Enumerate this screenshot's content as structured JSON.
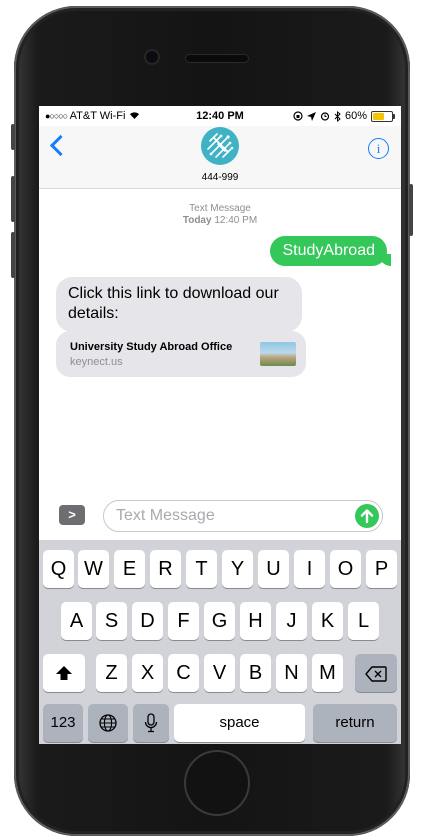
{
  "status_bar": {
    "signal": "●○○○○",
    "carrier": "AT&T Wi-Fi",
    "time": "12:40 PM",
    "battery_percent": "60%",
    "battery_level": 0.6
  },
  "nav": {
    "contact": "444-999",
    "info_glyph": "i"
  },
  "thread": {
    "meta_label": "Text Message",
    "meta_day": "Today",
    "meta_time": "12:40 PM",
    "outgoing_message": "StudyAbroad",
    "incoming_message": "Click this link to download our details:",
    "link_preview": {
      "title": "University Study Abroad Office",
      "url": "keynect.us"
    }
  },
  "composer": {
    "apps_glyph": ">",
    "placeholder": "Text Message"
  },
  "keyboard": {
    "row1": [
      "Q",
      "W",
      "E",
      "R",
      "T",
      "Y",
      "U",
      "I",
      "O",
      "P"
    ],
    "row2": [
      "A",
      "S",
      "D",
      "F",
      "G",
      "H",
      "J",
      "K",
      "L"
    ],
    "row3": [
      "Z",
      "X",
      "C",
      "V",
      "B",
      "N",
      "M"
    ],
    "numbers_label": "123",
    "space_label": "space",
    "return_label": "return"
  },
  "colors": {
    "accent_blue": "#157efb",
    "bubble_green": "#34c759",
    "bubble_gray": "#e5e5ea",
    "keyboard_bg": "#d1d3d9"
  }
}
